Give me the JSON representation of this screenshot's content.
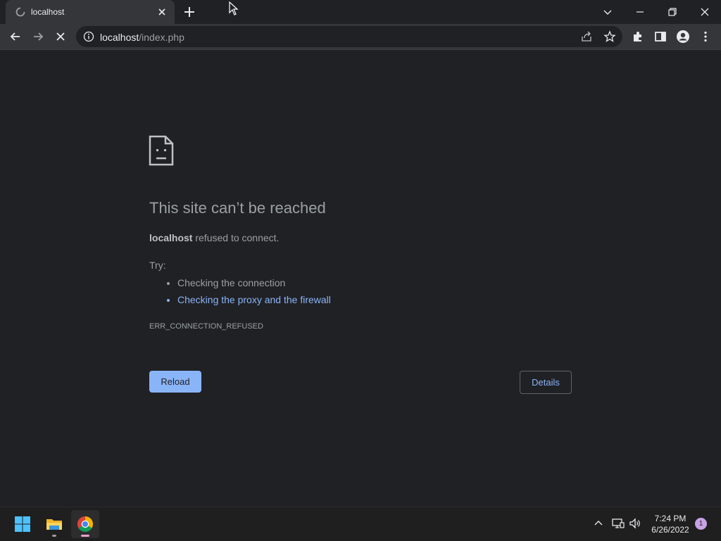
{
  "tab": {
    "title": "localhost"
  },
  "omnibox": {
    "host": "localhost",
    "path": "/index.php"
  },
  "error": {
    "heading": "This site can’t be reached",
    "host": "localhost",
    "message": " refused to connect.",
    "try_label": "Try:",
    "suggestions": [
      "Checking the connection",
      "Checking the proxy and the firewall"
    ],
    "code": "ERR_CONNECTION_REFUSED",
    "reload_label": "Reload",
    "details_label": "Details"
  },
  "taskbar": {
    "time": "7:24 PM",
    "date": "6/26/2022",
    "notification_count": "1"
  },
  "colors": {
    "background": "#202124",
    "link": "#8ab4f8",
    "button": "#8ab4f8"
  },
  "icons": [
    "loading-spinner-icon",
    "close-icon",
    "plus-icon",
    "cursor-icon",
    "chevron-down-icon",
    "minimize-icon",
    "restore-icon",
    "back-icon",
    "forward-icon",
    "stop-icon",
    "info-icon",
    "share-icon",
    "star-icon",
    "extensions-icon",
    "side-panel-icon",
    "profile-icon",
    "menu-icon",
    "sad-page-icon",
    "windows-start-icon",
    "file-explorer-icon",
    "chrome-icon",
    "chevron-up-icon",
    "network-icon",
    "volume-icon"
  ]
}
